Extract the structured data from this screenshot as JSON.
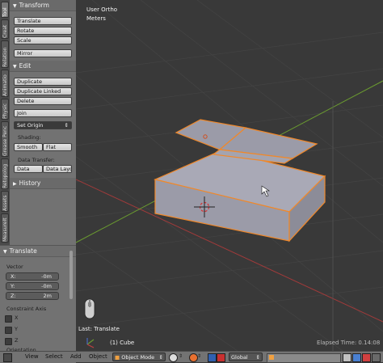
{
  "tabs": [
    {
      "label": "Tool",
      "active": true
    },
    {
      "label": "Creat",
      "active": false
    },
    {
      "label": "Relation",
      "active": false
    },
    {
      "label": "Animatio",
      "active": false
    },
    {
      "label": "Physic",
      "active": false
    },
    {
      "label": "Grease Penc",
      "active": false
    },
    {
      "label": "Retopolog",
      "active": false
    },
    {
      "label": "Assets",
      "active": false
    },
    {
      "label": "MeasureIt",
      "active": false
    }
  ],
  "transform": {
    "header": "Transform",
    "translate": "Translate",
    "rotate": "Rotate",
    "scale": "Scale",
    "mirror": "Mirror"
  },
  "edit": {
    "header": "Edit",
    "duplicate": "Duplicate",
    "duplicate_linked": "Duplicate Linked",
    "delete": "Delete",
    "join": "Join",
    "set_origin": "Set Origin",
    "shading_label": "Shading:",
    "smooth": "Smooth",
    "flat": "Flat",
    "data_transfer_label": "Data Transfer:",
    "data": "Data",
    "data_layout": "Data Layo"
  },
  "history": {
    "header": "History"
  },
  "redo_panel": {
    "header": "Translate",
    "vector_label": "Vector",
    "x_label": "X:",
    "x_value": "-0m",
    "y_label": "Y:",
    "y_value": "-0m",
    "z_label": "Z:",
    "z_value": "2m",
    "constraint_label": "Constraint Axis",
    "axes": [
      "X",
      "Y",
      "Z"
    ],
    "orientation_label": "Orientation"
  },
  "viewport": {
    "view_name": "User Ortho",
    "units": "Meters",
    "last_operator": "Last: Translate",
    "object_info": "(1) Cube",
    "elapsed": "Elapsed Time: 0.14:08"
  },
  "header": {
    "view": "View",
    "select": "Select",
    "add": "Add",
    "object": "Object",
    "mode": "Object Mode",
    "orientation": "Global"
  },
  "colors": {
    "selection_outline": "#f0882a",
    "mesh_face": "#9a9aa6",
    "axis_x": "#a03a3a",
    "axis_y": "#6a9a30"
  }
}
